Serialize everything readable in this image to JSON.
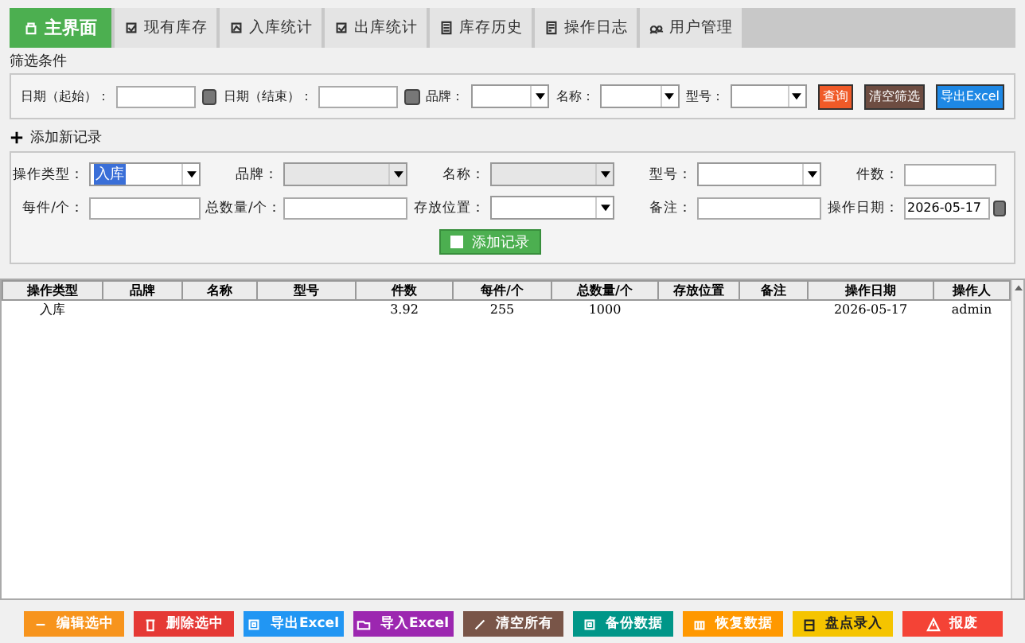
{
  "tabs": [
    {
      "label": "主界面",
      "selected": true
    },
    {
      "label": "现有库存",
      "selected": false
    },
    {
      "label": "入库统计",
      "selected": false
    },
    {
      "label": "出库统计",
      "selected": false
    },
    {
      "label": "库存历史",
      "selected": false
    },
    {
      "label": "操作日志",
      "selected": false
    },
    {
      "label": "用户管理",
      "selected": false
    }
  ],
  "filter": {
    "title": "筛选条件",
    "fields": [
      {
        "kind": "date",
        "label": "日期（起始）："
      },
      {
        "kind": "date",
        "label": "日期（结束）："
      },
      {
        "kind": "select",
        "label": "品牌："
      },
      {
        "kind": "select",
        "label": "名称："
      },
      {
        "kind": "select",
        "label": "型号："
      }
    ],
    "buttons": [
      {
        "label": "查询",
        "color": "#f05a28"
      },
      {
        "label": "清空筛选",
        "color": "#6d4c41"
      },
      {
        "label": "导出Excel",
        "color": "#1e88e5"
      }
    ]
  },
  "add_record": {
    "title": "添加新记录",
    "fields": [
      {
        "kind": "select",
        "label": "操作类型：",
        "value": "入库",
        "disabled": false
      },
      {
        "kind": "select",
        "label": "品牌：",
        "disabled": true
      },
      {
        "kind": "select",
        "label": "名称：",
        "disabled": true
      },
      {
        "kind": "select",
        "label": "型号：",
        "disabled": false
      },
      {
        "kind": "text",
        "label": "件数："
      },
      {
        "kind": "text",
        "label": "每件/个："
      },
      {
        "kind": "text",
        "label": "总数量/个："
      },
      {
        "kind": "select",
        "label": "存放位置：",
        "disabled": false
      },
      {
        "kind": "text",
        "label": "备注："
      },
      {
        "kind": "date",
        "label": "操作日期：",
        "value": "2026-05-17"
      }
    ],
    "submit": "添加记录"
  },
  "table": {
    "columns": [
      "操作类型",
      "品牌",
      "名称",
      "型号",
      "件数",
      "每件/个",
      "总数量/个",
      "存放位置",
      "备注",
      "操作日期",
      "操作人"
    ],
    "rows": [
      [
        "入库",
        "",
        "",
        "",
        "3.92",
        "255",
        "1000",
        "",
        "",
        "2026-05-17",
        "admin"
      ]
    ]
  },
  "actions": [
    {
      "label": "编辑选中",
      "color": "#f7941d"
    },
    {
      "label": "删除选中",
      "color": "#e53935"
    },
    {
      "label": "导出Excel",
      "color": "#2196f3"
    },
    {
      "label": "导入Excel",
      "color": "#9c27b0"
    },
    {
      "label": "清空所有",
      "color": "#795548"
    },
    {
      "label": "备份数据",
      "color": "#009688"
    },
    {
      "label": "恢复数据",
      "color": "#ff9800"
    },
    {
      "label": "盘点录入",
      "color": "#f5c400"
    },
    {
      "label": "报废",
      "color": "#f44336"
    }
  ]
}
